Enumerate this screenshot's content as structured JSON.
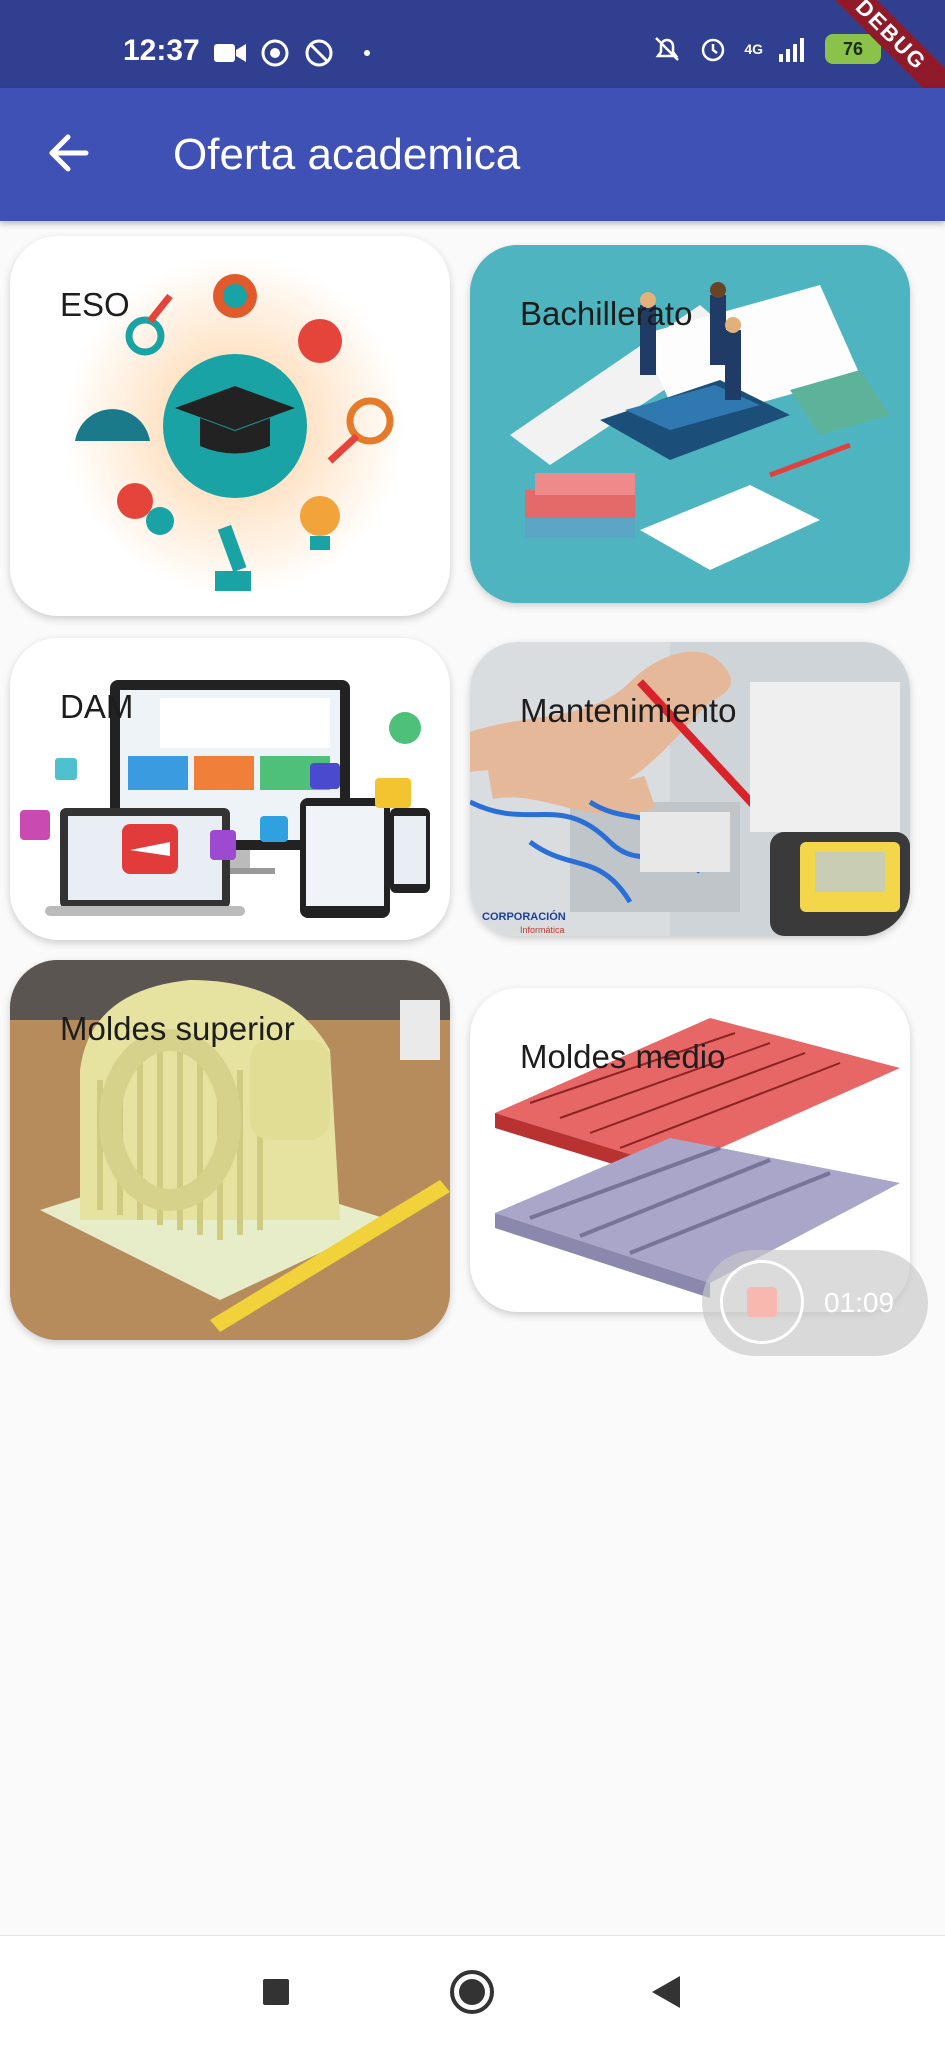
{
  "status": {
    "time": "12:37",
    "battery": "76",
    "network": "4G",
    "debug_banner": "DEBUG"
  },
  "appbar": {
    "title": "Oferta academica",
    "back_icon": "arrow-left-icon"
  },
  "cards": [
    {
      "label": "ESO",
      "image": "education-icons-illustration"
    },
    {
      "label": "Bachillerato",
      "image": "graduates-on-book-illustration"
    },
    {
      "label": "DAM",
      "image": "multi-device-web-illustration"
    },
    {
      "label": "Mantenimiento",
      "image": "electrical-panel-photo",
      "watermark": "CORPORACIÓN Informática"
    },
    {
      "label": "Moldes superior",
      "image": "3d-printed-mold-photo"
    },
    {
      "label": "Moldes medio",
      "image": "mold-plate-cad-render"
    }
  ],
  "recorder": {
    "time": "01:09"
  },
  "navbar": {
    "items": [
      "recent-apps-icon",
      "home-icon",
      "back-icon"
    ]
  },
  "colors": {
    "statusbar": "#303f8f",
    "appbar": "#3f51b5",
    "background": "#fafafa"
  }
}
